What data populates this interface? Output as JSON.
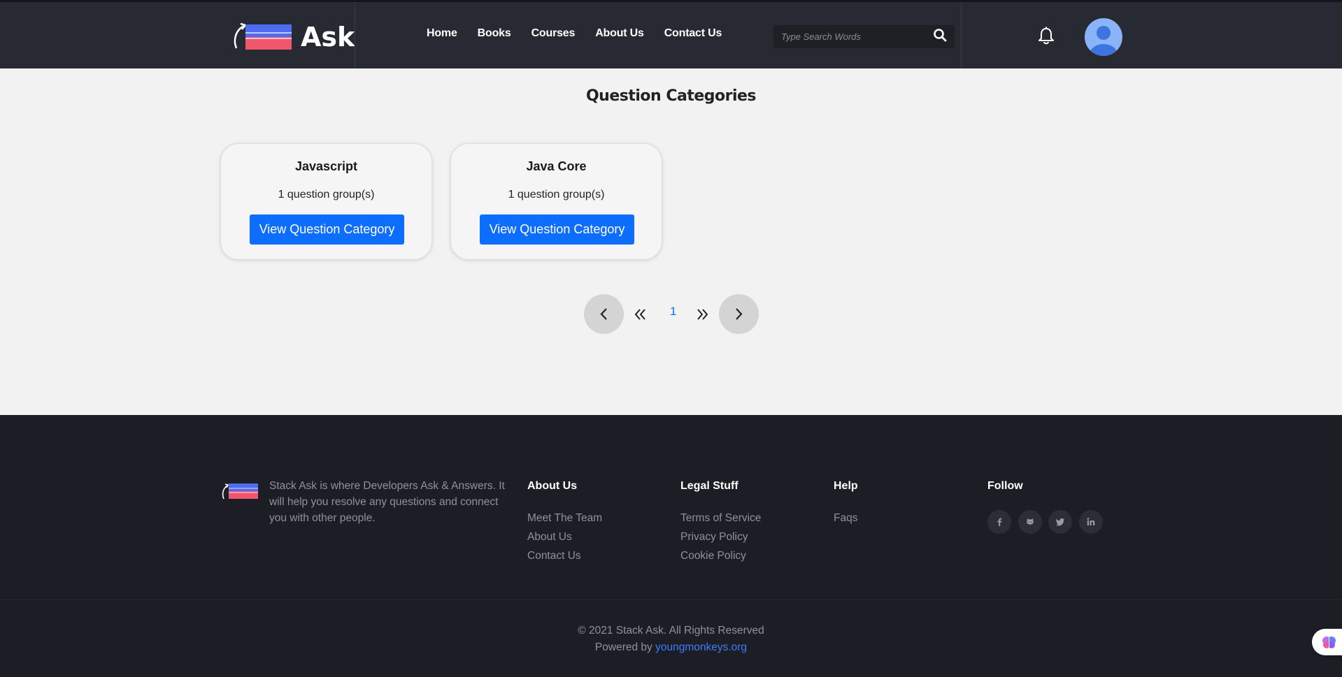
{
  "header": {
    "logo_text": "Ask",
    "nav": [
      "Home",
      "Books",
      "Courses",
      "About Us",
      "Contact Us"
    ],
    "search_placeholder": "Type Search Words"
  },
  "main": {
    "title": "Question Categories",
    "categories": [
      {
        "name": "Javascript",
        "count": "1 question group(s)",
        "button": "View Question Category"
      },
      {
        "name": "Java Core",
        "count": "1 question group(s)",
        "button": "View Question Category"
      }
    ],
    "pagination": {
      "current": "1"
    }
  },
  "footer": {
    "description": "Stack Ask is where Developers Ask & Answers. It will help you resolve any questions and connect you with other people.",
    "columns": [
      {
        "title": "About Us",
        "links": [
          "Meet The Team",
          "About Us",
          "Contact Us"
        ]
      },
      {
        "title": "Legal Stuff",
        "links": [
          "Terms of Service",
          "Privacy Policy",
          "Cookie Policy"
        ]
      },
      {
        "title": "Help",
        "links": [
          "Faqs"
        ]
      },
      {
        "title": "Follow",
        "links": []
      }
    ],
    "social": [
      "facebook-icon",
      "github-icon",
      "twitter-icon",
      "linkedin-icon"
    ],
    "copyright": "© 2021 Stack Ask. All Rights Reserved",
    "powered_prefix": "Powered by",
    "powered_link": "youngmonkeys.org"
  },
  "colors": {
    "header_bg": "#272a32",
    "footer_bg": "#1d1e25",
    "accent": "#0d6efd",
    "logo_blue": "#4e6cf0",
    "logo_red": "#f0566e"
  }
}
